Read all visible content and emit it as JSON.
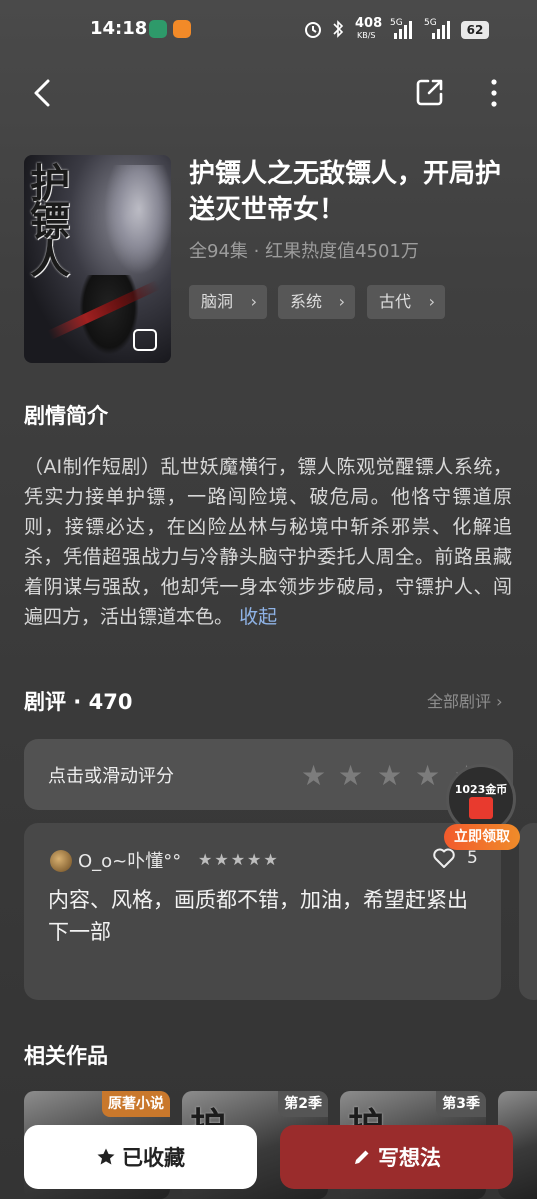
{
  "status_bar": {
    "time": "14:18",
    "net_speed_top": "408",
    "net_speed_unit": "KB/S",
    "sig1": "5G",
    "sig2": "5G",
    "battery": "62",
    "app_icons": [
      "app-icon-green",
      "app-icon-orange"
    ]
  },
  "nav": {
    "back_icon": "chevron-left-icon",
    "share_icon": "share-icon",
    "more_icon": "more-vertical-icon"
  },
  "show": {
    "cover_art_text": "护镖人",
    "title": "护镖人之无敌镖人，开局护送灭世帝女！",
    "meta": "全94集 · 红果热度值4501万",
    "tags": [
      {
        "label": "脑洞"
      },
      {
        "label": "系统"
      },
      {
        "label": "古代"
      }
    ]
  },
  "synopsis": {
    "heading": "剧情简介",
    "text": "（AI制作短剧）乱世妖魔横行，镖人陈观觉醒镖人系统，凭实力接单护镖，一路闯险境、破危局。他恪守镖道原则，接镖必达，在凶险丛林与秘境中斩杀邪祟、化解追杀，凭借超强战力与冷静头脑守护委托人周全。前路虽藏着阴谋与强敌，他却凭一身本领步步破局，守镖护人、闯遍四方，活出镖道本色。",
    "collapse_label": "收起"
  },
  "reviews": {
    "heading": "剧评 · 470",
    "all_label": "全部剧评",
    "rate_prompt": "点击或滑动评分",
    "rate_stars": 5,
    "items": [
      {
        "user": "O_o~卟懂°°",
        "stars": "★★★★★",
        "likes": "5",
        "text": "内容、风格，画质都不错，加油，希望赶紧出下一部"
      }
    ]
  },
  "coin_widget": {
    "amount": "1023金币",
    "cta": "立即领取"
  },
  "related": {
    "heading": "相关作品",
    "items": [
      {
        "badge": "原著小说",
        "badge_color": "#c9782c"
      },
      {
        "badge": "第2季",
        "badge_color": "#555555",
        "art": "护"
      },
      {
        "badge": "第3季",
        "badge_color": "#555555",
        "art": "护"
      }
    ]
  },
  "bottom_bar": {
    "collect_label": "已收藏",
    "write_label": "写想法",
    "collect_icon": "star-icon",
    "write_icon": "pencil-icon"
  },
  "colors": {
    "accent_red": "#9a2c2c",
    "link_blue": "#8fb3e6",
    "coin_orange": "#f25a2c"
  }
}
